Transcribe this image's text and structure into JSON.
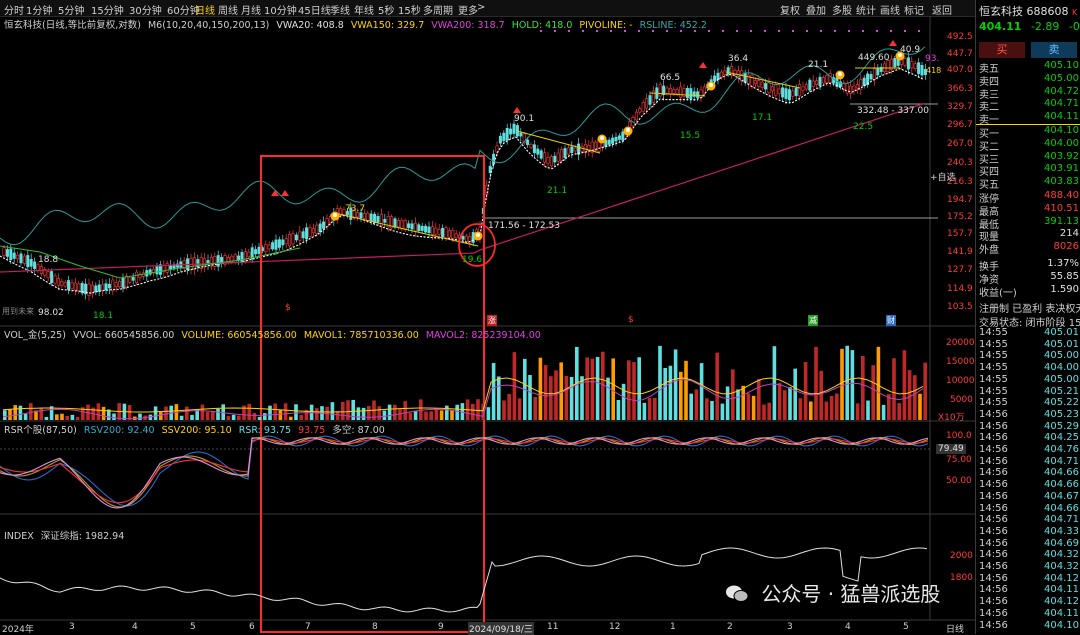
{
  "toolbar": {
    "periods": [
      "分时",
      "1分钟",
      "5分钟",
      "15分钟",
      "30分钟",
      "60分钟",
      "日线",
      "周线",
      "月线",
      "10分钟",
      "45日线",
      "季线",
      "年线",
      "5秒",
      "15秒",
      "多周期",
      "更多"
    ],
    "active": "日线",
    "right": [
      "复权",
      "叠加",
      "多股",
      "统计",
      "画线",
      "标记",
      "返回"
    ],
    "more_suffix": ">"
  },
  "main_header": {
    "name": "恒玄科技(日线,等比前复权,对数)",
    "m6": "M6(10,20,40,150,200,13)",
    "vwa20": "VWA20: 408.8",
    "vwa150": "VWA150: 329.7",
    "vwa200": "VWA200: 318.7",
    "hold": "HOLD: 418.0",
    "pivoline": "PIVOLINE: -",
    "rsline": "RSLINE: 452.2"
  },
  "price_axis": [
    "492.5",
    "447.7",
    "407.0",
    "366.3",
    "329.7",
    "296.7",
    "267.0",
    "240.3",
    "216.3",
    "194.7",
    "175.2",
    "157.7",
    "141.9",
    "127.7",
    "114.9",
    "103.5"
  ],
  "price_axis_extra": "+自选",
  "price_labels": {
    "p1": "18.8",
    "p2": "98.02",
    "p3": "18.1",
    "p4": "73.7",
    "p5": "19.6",
    "p6": "171.56 - 172.53",
    "p7": "90.1",
    "p8": "21.1",
    "p9": "66.5",
    "p10": "15.5",
    "p11": "36.4",
    "p12": "17.1",
    "p13": "21.1",
    "p14": "449.60",
    "p15": "40.9",
    "p16": "93.",
    "p17": "332.48 - 337.00",
    "p18": "22.5",
    "p19": "418",
    "corner": "用到未来"
  },
  "event_marks": {
    "s1": "$",
    "s2": "涨",
    "s3": "$",
    "s4": "减",
    "s5": "财"
  },
  "vol_header": {
    "name": "VOL_金(5,25)",
    "vvol": "VVOL: 660545856.00",
    "volume": "VOLUME: 660545856.00",
    "mavol1": "MAVOL1: 785710336.00",
    "mavol2": "MAVOL2: 825239104.00"
  },
  "vol_axis": [
    "20000",
    "15000",
    "10000",
    "5000"
  ],
  "vol_unit": "X10万",
  "rsi_header": {
    "name": "RSR个股(87,50)",
    "rsv": "RSV200: 92.40",
    "ssv": "SSV200: 95.10",
    "rsr": "RSR: 93.75",
    "v1": "93.75",
    "kong": "多空: 87.00"
  },
  "rsi_axis": [
    "100.0",
    "75.00",
    "50.00"
  ],
  "rsi_current": "79.49",
  "index_header": {
    "name": "INDEX",
    "label": "深证综指: 1982.94"
  },
  "index_axis": [
    "2000",
    "1800"
  ],
  "date_axis": {
    "year": "2024年",
    "m3": "3",
    "m4": "4",
    "m5": "5",
    "m6": "6",
    "m7": "7",
    "m8": "8",
    "m9": "9",
    "date": "2024/09/18/三",
    "m11": "11",
    "m12": "12",
    "m1": "1",
    "m2": "2",
    "m3b": "3",
    "m4b": "4",
    "m5b": "5",
    "period": "日线"
  },
  "panel": {
    "title": "恒玄科技 688608",
    "tag": "K",
    "price": "404.11",
    "change": "-2.89",
    "pct": "-0.71%",
    "buy_btn": "买",
    "sell_btn": "卖",
    "asks": [
      {
        "k": "卖五",
        "v": "405.10"
      },
      {
        "k": "卖四",
        "v": "405.00"
      },
      {
        "k": "卖三",
        "v": "404.72"
      },
      {
        "k": "卖二",
        "v": "404.71"
      },
      {
        "k": "卖一",
        "v": "404.11"
      }
    ],
    "bids": [
      {
        "k": "买一",
        "v": "404.10"
      },
      {
        "k": "买二",
        "v": "404.00"
      },
      {
        "k": "买三",
        "v": "403.92"
      },
      {
        "k": "买四",
        "v": "403.91"
      },
      {
        "k": "买五",
        "v": "403.83"
      }
    ],
    "stats1": [
      {
        "k": "涨停",
        "v": "488.40",
        "c": "red"
      },
      {
        "k": "最高",
        "v": "410.51",
        "c": "red"
      },
      {
        "k": "最低",
        "v": "391.13",
        "c": "green"
      },
      {
        "k": "现量",
        "v": "214",
        "c": "white"
      },
      {
        "k": "外盘",
        "v": "8026",
        "c": "red"
      }
    ],
    "stats2": [
      {
        "k": "换手",
        "v": "1.37%",
        "c": "white"
      },
      {
        "k": "净资",
        "v": "55.85",
        "c": "white"
      },
      {
        "k": "收益(一)",
        "v": "1.590",
        "c": "white"
      }
    ],
    "flags": "注册制 已盈利 表决权无",
    "status": "交易状态: 闭市阶段 15:3",
    "ticks": [
      {
        "t": "14:55",
        "v": "405.01"
      },
      {
        "t": "14:55",
        "v": "405.01"
      },
      {
        "t": "14:55",
        "v": "405.00"
      },
      {
        "t": "14:55",
        "v": "404.00"
      },
      {
        "t": "14:55",
        "v": "405.00"
      },
      {
        "t": "14:55",
        "v": "405.21"
      },
      {
        "t": "14:55",
        "v": "405.22"
      },
      {
        "t": "14:56",
        "v": "405.23"
      },
      {
        "t": "14:56",
        "v": "405.29"
      },
      {
        "t": "14:56",
        "v": "404.25"
      },
      {
        "t": "14:56",
        "v": "404.76"
      },
      {
        "t": "14:56",
        "v": "404.71"
      },
      {
        "t": "14:56",
        "v": "404.66"
      },
      {
        "t": "14:56",
        "v": "404.66"
      },
      {
        "t": "14:56",
        "v": "404.67"
      },
      {
        "t": "14:56",
        "v": "404.66"
      },
      {
        "t": "14:56",
        "v": "404.71"
      },
      {
        "t": "14:56",
        "v": "404.33"
      },
      {
        "t": "14:56",
        "v": "404.69"
      },
      {
        "t": "14:56",
        "v": "404.32"
      },
      {
        "t": "14:56",
        "v": "404.32"
      },
      {
        "t": "14:56",
        "v": "404.12"
      },
      {
        "t": "14:56",
        "v": "404.11"
      },
      {
        "t": "14:56",
        "v": "404.12"
      },
      {
        "t": "14:56",
        "v": "404.11"
      },
      {
        "t": "14:56",
        "v": "404.10"
      }
    ]
  },
  "watermark": "公众号 · 猛兽派选股",
  "colors": {
    "red": "#ff3b3b",
    "green": "#00d000",
    "cyan": "#5ee0e0",
    "yellow": "#ffd400",
    "magenta": "#e040e0",
    "highlight": "#ff2a2a"
  }
}
